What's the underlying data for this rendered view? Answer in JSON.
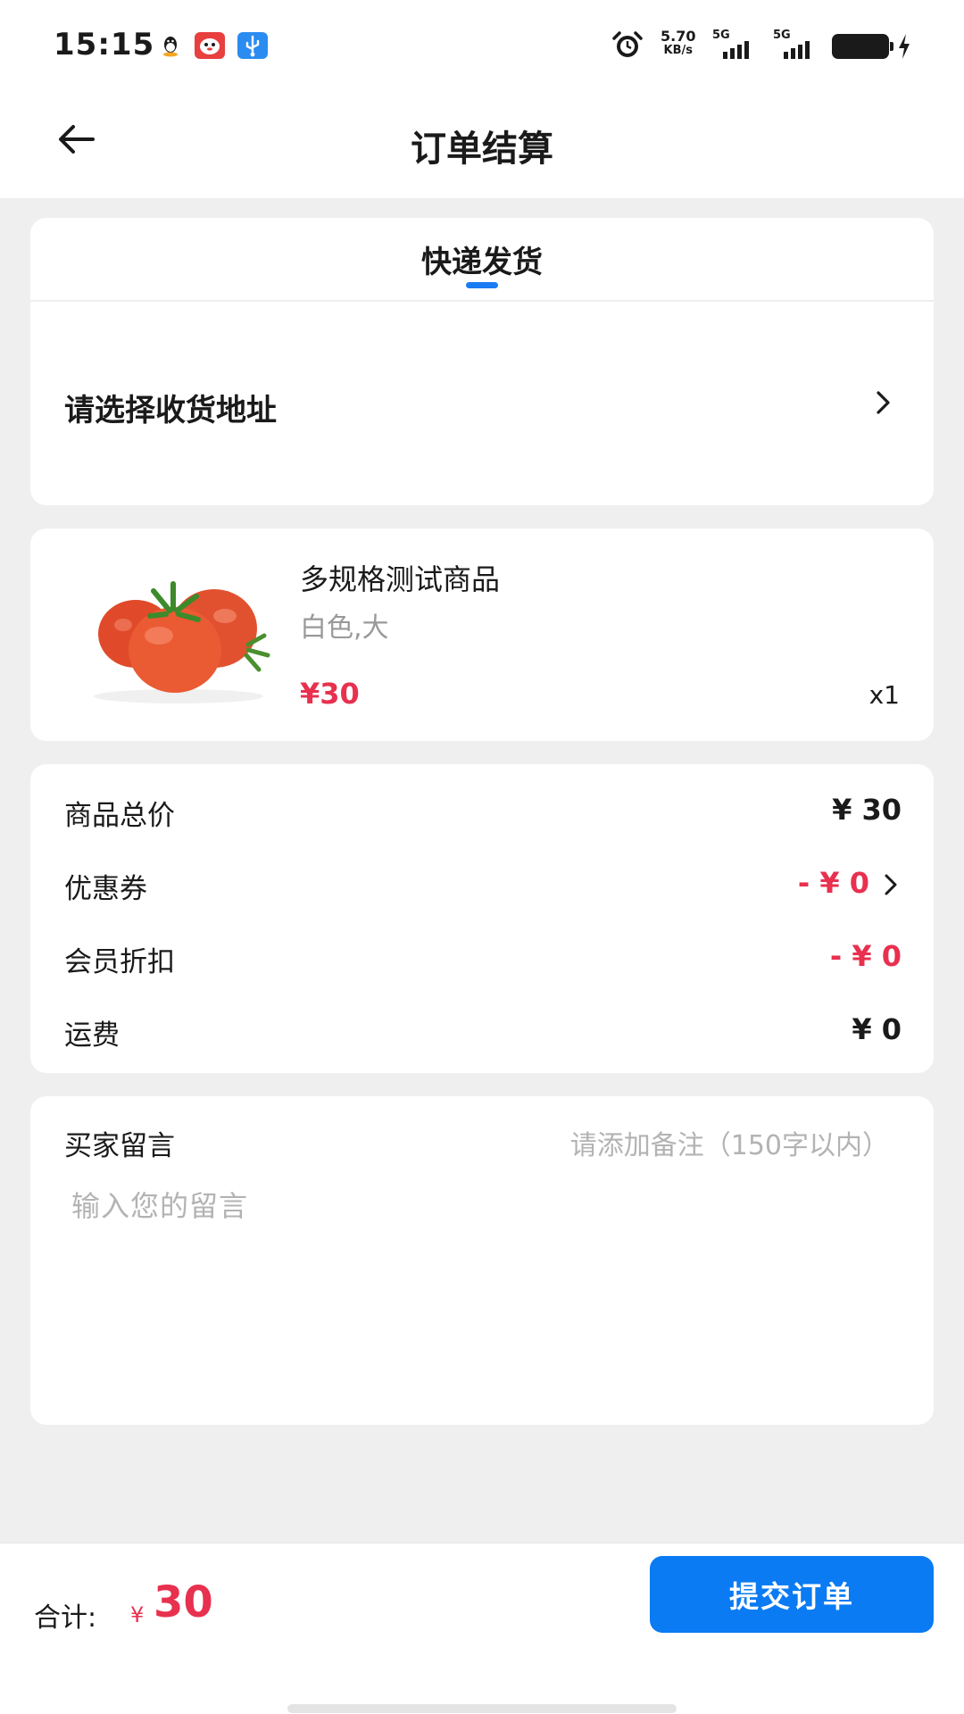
{
  "status_bar": {
    "time": "15:15",
    "net_speed": "5.70",
    "net_unit": "KB/s",
    "signal1_label": "5G",
    "signal2_label": "5G",
    "icons": [
      "qq-icon",
      "app-red-icon",
      "usb-icon",
      "alarm-icon",
      "signal-icon",
      "battery-icon",
      "charging-icon"
    ]
  },
  "header": {
    "title": "订单结算",
    "back_icon": "arrow-left-icon"
  },
  "shipping": {
    "tab_label": "快递发货",
    "address_prompt": "请选择收货地址"
  },
  "product": {
    "name": "多规格测试商品",
    "spec": "白色,大",
    "price": "¥30",
    "quantity": "x1",
    "image": "tomatoes"
  },
  "summary": {
    "rows": [
      {
        "label": "商品总价",
        "value": "¥ 30"
      },
      {
        "label": "优惠券",
        "value": "- ¥ 0"
      },
      {
        "label": "会员折扣",
        "value": "- ¥ 0"
      },
      {
        "label": "运费",
        "value": "¥ 0"
      }
    ]
  },
  "message": {
    "label": "买家留言",
    "hint": "请添加备注（150字以内）",
    "placeholder": "输入您的留言"
  },
  "footer": {
    "total_label": "合计:",
    "currency": "¥",
    "total": "30",
    "submit_label": "提交订单"
  },
  "colors": {
    "accent_blue": "#0a7bf2",
    "price_red": "#e8304f",
    "background": "#efefef"
  }
}
